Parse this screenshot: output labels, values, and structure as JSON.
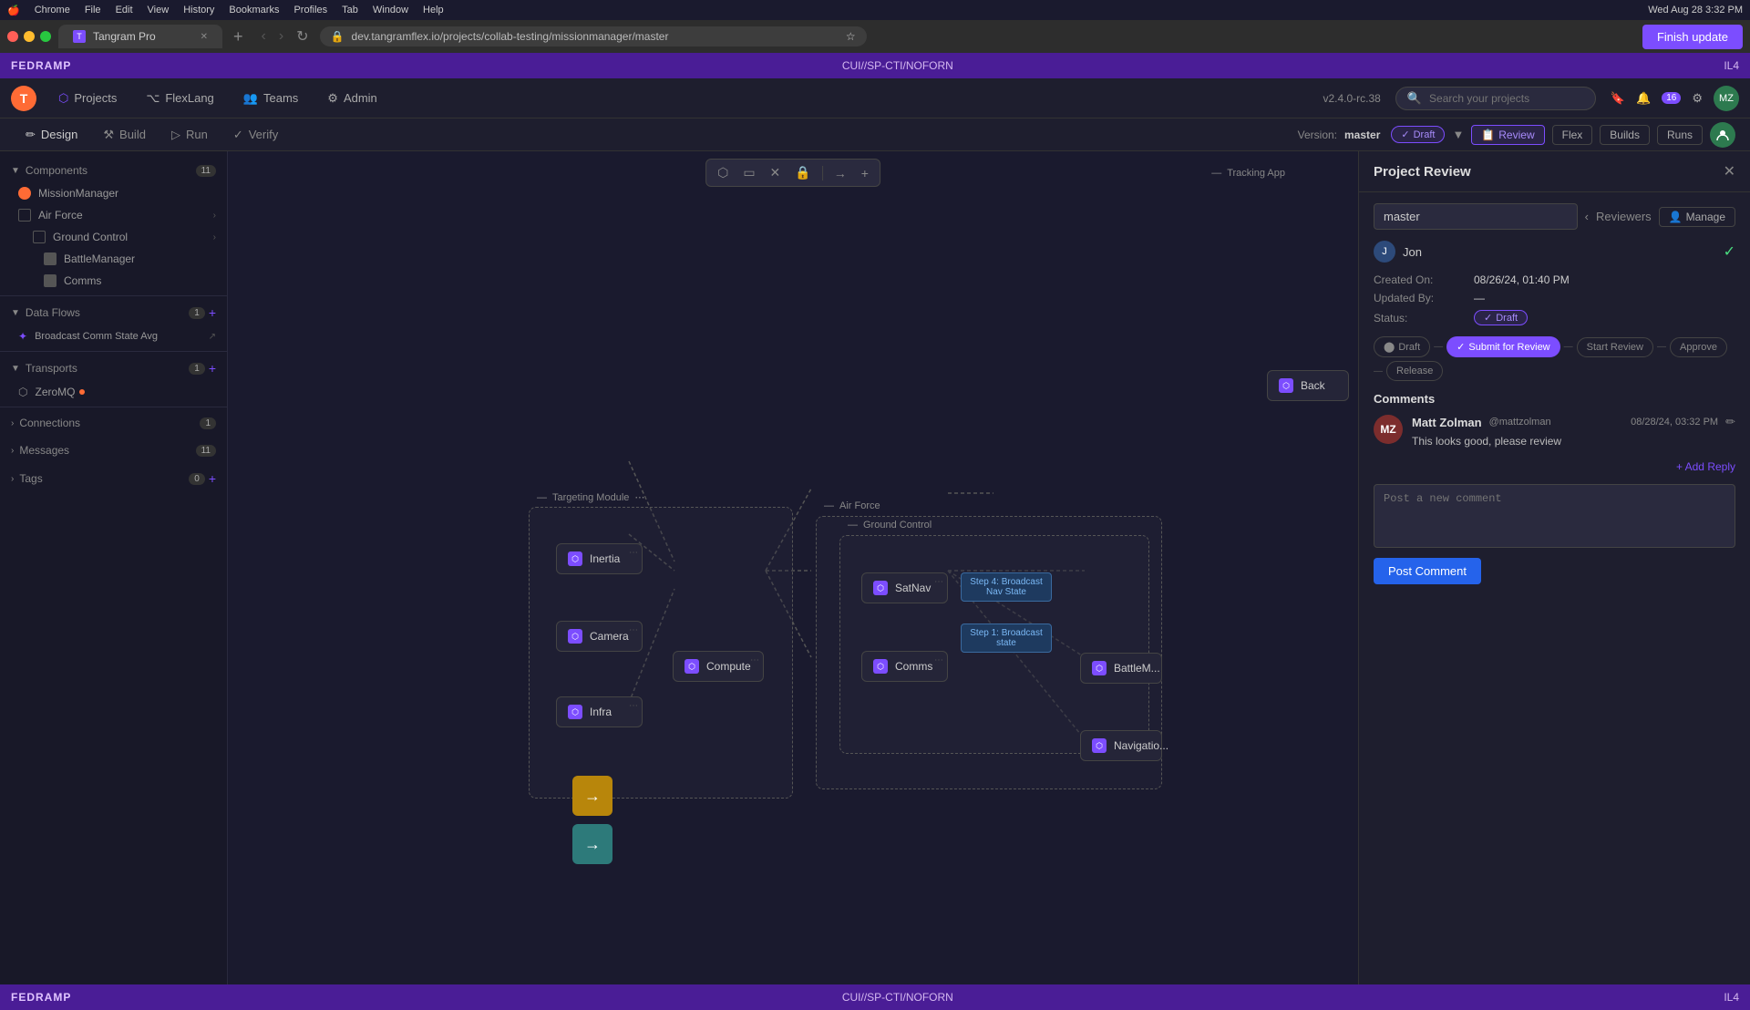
{
  "chrome": {
    "tab_title": "Tangram Pro",
    "url": "dev.tangramflex.io/projects/collab-testing/missionmanager/master",
    "finish_update": "Finish update",
    "new_tab_symbol": "+"
  },
  "sys_bar": {
    "apple": "🍎",
    "items": [
      "Chrome",
      "File",
      "Edit",
      "View",
      "History",
      "Bookmarks",
      "Profiles",
      "Tab",
      "Window",
      "Help"
    ],
    "time": "Wed Aug 28  3:32 PM"
  },
  "fedramp": {
    "label": "FEDRAMP",
    "center": "CUI//SP-CTI/NOFORN",
    "right": "IL4",
    "bottom_label": "FEDRAMP",
    "bottom_center": "CUI//SP-CTI/NOFORN",
    "bottom_right": "IL4"
  },
  "app_nav": {
    "logo": "T",
    "projects": "Projects",
    "flexlang": "FlexLang",
    "teams": "Teams",
    "admin": "Admin",
    "version": "v2.4.0-rc.38",
    "search_placeholder": "Search your projects",
    "notification_count": "16",
    "avatar_initials": "MZ"
  },
  "sub_nav": {
    "design": "Design",
    "build": "Build",
    "run": "Run",
    "verify": "Verify",
    "version_label": "Version:",
    "version_value": "master",
    "draft_label": "Draft",
    "review_label": "Review",
    "flex_label": "Flex",
    "builds_label": "Builds",
    "runs_label": "Runs"
  },
  "sidebar": {
    "components_label": "Components",
    "components_count": "11",
    "mission_manager": "MissionManager",
    "air_force": "Air Force",
    "ground_control": "Ground Control",
    "battle_manager": "BattleManager",
    "comms": "Comms",
    "data_flows_label": "Data Flows",
    "data_flows_count": "1",
    "broadcast_flow": "Broadcast Comm State Avg",
    "transports_label": "Transports",
    "transports_count": "1",
    "zeromq": "ZeroMQ",
    "connections_label": "Connections",
    "connections_count": "1",
    "messages_label": "Messages",
    "messages_count": "11",
    "tags_label": "Tags",
    "tags_count": "0"
  },
  "canvas": {
    "tracking_app_label": "Tracking App",
    "backend_label": "Back",
    "targeting_module_label": "Targeting Module",
    "air_force_label": "Air Force",
    "ground_control_label": "Ground Control",
    "nodes": [
      {
        "id": "inertia",
        "label": "Inertia"
      },
      {
        "id": "camera",
        "label": "Camera"
      },
      {
        "id": "compute",
        "label": "Compute"
      },
      {
        "id": "infra",
        "label": "Infra"
      },
      {
        "id": "satnav",
        "label": "SatNav"
      },
      {
        "id": "comms",
        "label": "Comms"
      },
      {
        "id": "battlemanager",
        "label": "BattleM..."
      },
      {
        "id": "navigation",
        "label": "Navigatio..."
      }
    ],
    "step_boxes": [
      {
        "id": "step4",
        "label": "Step 4: Broadcast Nav State"
      },
      {
        "id": "step1",
        "label": "Step 1: Broadcast state"
      }
    ]
  },
  "review_panel": {
    "title": "Project Review",
    "name": "master",
    "reviewers_label": "Reviewers",
    "manage_label": "Manage",
    "created_on_label": "Created On:",
    "created_on_value": "08/26/24, 01:40 PM",
    "updated_by_label": "Updated By:",
    "updated_by_value": "—",
    "status_label": "Status:",
    "status_value": "Draft",
    "reviewer_name": "Jon",
    "workflow": {
      "draft": "Draft",
      "submit": "Submit for Review",
      "start_review": "Start Review",
      "approve": "Approve",
      "release": "Release"
    },
    "comments": {
      "label": "Comments",
      "items": [
        {
          "name": "Matt Zolman",
          "handle": "@mattzolman",
          "time": "08/28/24, 03:32 PM",
          "text": "This looks good, please review",
          "avatar_initials": "MZ"
        }
      ],
      "add_reply": "+ Add Reply",
      "new_comment_placeholder": "Post a new comment",
      "post_button": "Post Comment"
    }
  }
}
